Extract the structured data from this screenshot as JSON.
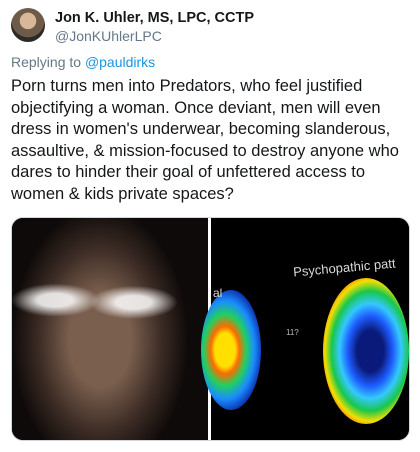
{
  "tweet": {
    "author": {
      "display_name": "Jon K. Uhler, MS, LPC, CCTP",
      "handle": "@JonKUhlerLPC"
    },
    "reply_prefix": "Replying to",
    "reply_mention": "@pauldirks",
    "text_lines": [
      "Porn turns men into Predators, who feel justified",
      "objectifying a woman. Once deviant, men will even",
      "dress in women's underwear, becoming slanderous,",
      "assaultive, & mission-focused to destroy anyone who",
      "dares to hinder their goal of unfettered access to",
      "women & kids private spaces?"
    ],
    "media": {
      "right_image_title": "Psychopathic patt",
      "right_image_small_label": "al",
      "right_image_marker": "11?"
    }
  }
}
